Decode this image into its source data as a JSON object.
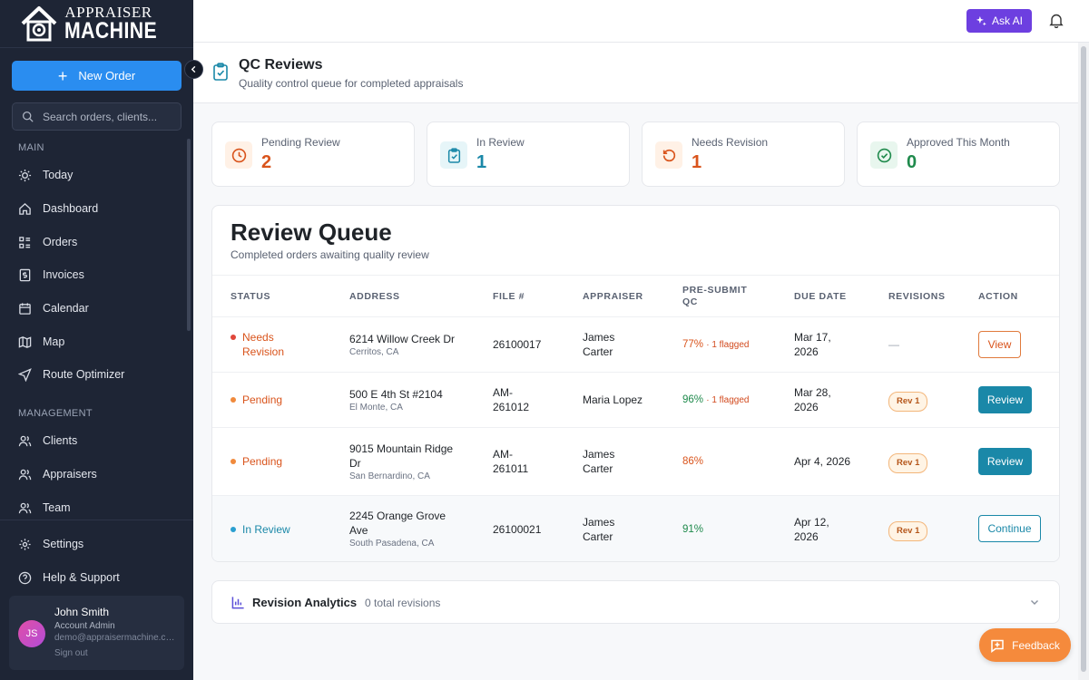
{
  "brand": {
    "line1": "APPRAISER",
    "line2": "MACHINE"
  },
  "sidebar": {
    "new_order_label": "New Order",
    "search_placeholder": "Search orders, clients...",
    "sections": {
      "main": "MAIN",
      "management": "MANAGEMENT"
    },
    "main_items": [
      {
        "label": "Today",
        "icon": "sun-icon"
      },
      {
        "label": "Dashboard",
        "icon": "home-icon"
      },
      {
        "label": "Orders",
        "icon": "list-icon"
      },
      {
        "label": "Invoices",
        "icon": "invoice-icon"
      },
      {
        "label": "Calendar",
        "icon": "calendar-icon"
      },
      {
        "label": "Map",
        "icon": "map-icon"
      },
      {
        "label": "Route Optimizer",
        "icon": "navigation-icon"
      }
    ],
    "management_items": [
      {
        "label": "Clients",
        "icon": "users-icon"
      },
      {
        "label": "Appraisers",
        "icon": "users-icon"
      },
      {
        "label": "Team",
        "icon": "users-icon"
      }
    ],
    "bottom_items": [
      {
        "label": "Settings",
        "icon": "gear-icon"
      },
      {
        "label": "Help & Support",
        "icon": "help-icon"
      }
    ],
    "user": {
      "initials": "JS",
      "name": "John Smith",
      "role": "Account Admin",
      "email": "demo@appraisermachine.com",
      "signout": "Sign out"
    }
  },
  "topbar": {
    "ask_ai_label": "Ask AI"
  },
  "page": {
    "title": "QC Reviews",
    "subtitle": "Quality control queue for completed appraisals"
  },
  "stats": [
    {
      "label": "Pending Review",
      "value": "2",
      "color": "#d9541c",
      "bg": "#fff1e6"
    },
    {
      "label": "In Review",
      "value": "1",
      "color": "#1a88a8",
      "bg": "#e6f5f8"
    },
    {
      "label": "Needs Revision",
      "value": "1",
      "color": "#d9541c",
      "bg": "#fff1e6"
    },
    {
      "label": "Approved This Month",
      "value": "0",
      "color": "#1f8a4c",
      "bg": "#e8f6ee"
    }
  ],
  "queue": {
    "title": "Review Queue",
    "subtitle": "Completed orders awaiting quality review",
    "columns": {
      "status": "STATUS",
      "address": "ADDRESS",
      "file": "FILE #",
      "appraiser": "APPRAISER",
      "qc1": "PRE-SUBMIT",
      "qc2": "QC",
      "due": "DUE DATE",
      "revisions": "REVISIONS",
      "action": "ACTION"
    },
    "rows": [
      {
        "status1": "Needs",
        "status2": "Revision",
        "status_color": "#d9541c",
        "dot_color": "#e0473a",
        "addr1": "6214 Willow Creek Dr",
        "addr2": "",
        "city": "Cerritos, CA",
        "file1": "26100017",
        "file2": "",
        "appr1": "James",
        "appr2": "Carter",
        "qc": "77%",
        "qc_color": "#d9541c",
        "flag": "· 1 flagged",
        "due1": "Mar 17,",
        "due2": "2026",
        "revisions": "—",
        "action": "View"
      },
      {
        "status1": "Pending",
        "status2": "",
        "status_color": "#d9541c",
        "dot_color": "#f08a3c",
        "addr1": "500 E 4th St #2104",
        "addr2": "",
        "city": "El Monte, CA",
        "file1": "AM-",
        "file2": "261012",
        "appr1": "Maria Lopez",
        "appr2": "",
        "qc": "96%",
        "qc_color": "#1f8a4c",
        "flag": "· 1 flagged",
        "due1": "Mar 28,",
        "due2": "2026",
        "revisions": "Rev 1",
        "action": "Review"
      },
      {
        "status1": "Pending",
        "status2": "",
        "status_color": "#d9541c",
        "dot_color": "#f08a3c",
        "addr1": "9015 Mountain Ridge",
        "addr2": "Dr",
        "city": "San Bernardino, CA",
        "file1": "AM-",
        "file2": "261011",
        "appr1": "James",
        "appr2": "Carter",
        "qc": "86%",
        "qc_color": "#d9541c",
        "flag": "",
        "due1": "Apr 4, 2026",
        "due2": "",
        "revisions": "Rev 1",
        "action": "Review"
      },
      {
        "status1": "In Review",
        "status2": "",
        "status_color": "#1a88a8",
        "dot_color": "#2a9fd0",
        "addr1": "2245 Orange Grove",
        "addr2": "Ave",
        "city": "South Pasadena, CA",
        "file1": "26100021",
        "file2": "",
        "appr1": "James",
        "appr2": "Carter",
        "qc": "91%",
        "qc_color": "#1f8a4c",
        "flag": "",
        "due1": "Apr 12,",
        "due2": "2026",
        "revisions": "Rev 1",
        "action": "Continue"
      }
    ]
  },
  "analytics": {
    "title": "Revision Analytics",
    "subtitle": "0 total revisions"
  },
  "feedback_label": "Feedback"
}
